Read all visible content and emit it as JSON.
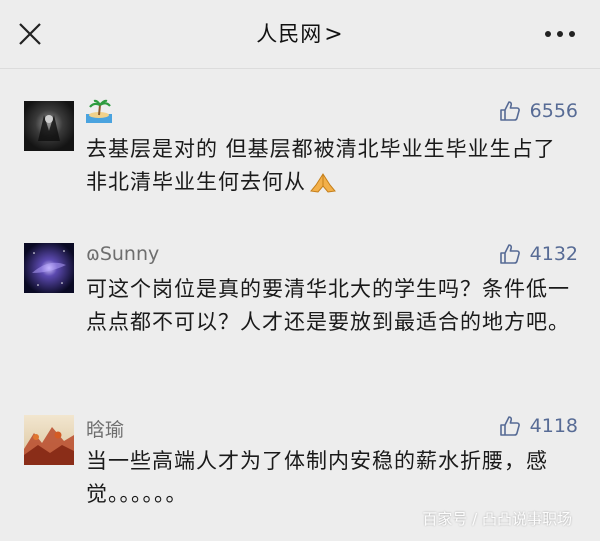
{
  "header": {
    "title": "人民网",
    "chevron": ">",
    "close_icon": "close-icon",
    "more_icon": "more-dots-icon"
  },
  "comments": [
    {
      "user": "🏝",
      "avatar": "dark-figure-avatar",
      "likes": "6556",
      "text": "去基层是对的 但基层都被清北毕业生毕业生占了 非北清毕业生何去何从",
      "emoji": "pray-hands-emoji"
    },
    {
      "user": "ɷSunny",
      "avatar": "galaxy-avatar",
      "likes": "4132",
      "text": "可这个岗位是真的要清华北大的学生吗？条件低一点点都不可以？人才还是要放到最适合的地方吧。"
    },
    {
      "user": "晗瑜",
      "avatar": "autumn-landscape-avatar",
      "likes": "4118",
      "text": "当一些高端人才为了体制内安稳的薪水折腰，感觉。。。。。。"
    }
  ],
  "watermark": "百家号 / 凸凸说事职场",
  "colors": {
    "background": "#ededed",
    "like": "#576b95",
    "username": "#6e6e6e"
  }
}
